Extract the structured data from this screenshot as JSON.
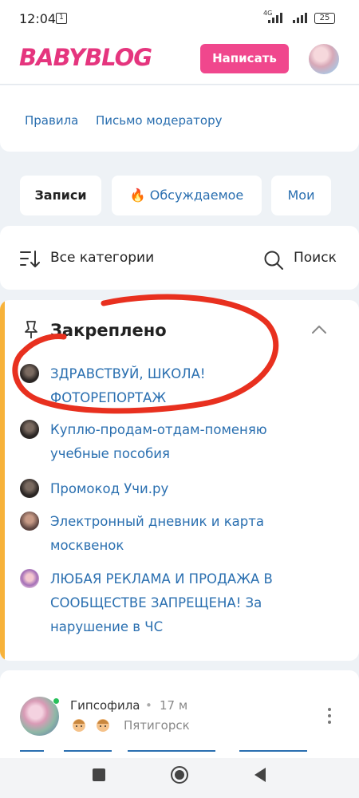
{
  "status": {
    "time": "12:04",
    "notif_count": "1",
    "network": "4G",
    "battery": "25"
  },
  "header": {
    "logo": "BABYBLOG",
    "write_button": "Написать"
  },
  "links": {
    "rules": "Правила",
    "moderator": "Письмо модератору"
  },
  "tabs": [
    {
      "label": "Записи",
      "active": true
    },
    {
      "label": "Обсуждаемое",
      "icon": "fire-icon"
    },
    {
      "label": "Мои"
    }
  ],
  "filter": {
    "categories": "Все категории",
    "search": "Поиск"
  },
  "pinned": {
    "title": "Закреплено",
    "items": [
      {
        "title": "ЗДРАВСТВУЙ, ШКОЛА! ФОТОРЕПОРТАЖ"
      },
      {
        "title": "Куплю-продам-отдам-поменяю учебные пособия"
      },
      {
        "title": "Промокод Учи.ру"
      },
      {
        "title": "Электронный дневник и карта москвенок"
      },
      {
        "title": "ЛЮБАЯ РЕКЛАМА И ПРОДАЖА В СООБЩЕСТВЕ ЗАПРЕЩЕНА! За нарушение в ЧС"
      }
    ]
  },
  "post": {
    "author": "Гипсофила",
    "separator": "•",
    "time": "17 м",
    "city": "Пятигорск"
  },
  "colors": {
    "accent": "#f0478d",
    "link": "#2a6fb0",
    "pinned_bar": "#f7b23a",
    "annotation": "#e8301f"
  }
}
